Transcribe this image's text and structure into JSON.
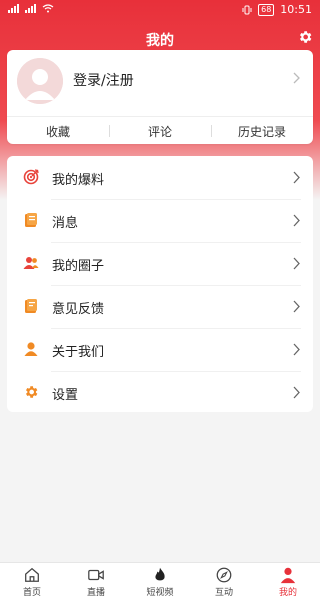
{
  "status_bar": {
    "battery": "68",
    "time": "10:51"
  },
  "header": {
    "title": "我的"
  },
  "profile": {
    "login_label": "登录/注册"
  },
  "profile_tabs": [
    "收藏",
    "评论",
    "历史记录"
  ],
  "menu": {
    "items": [
      {
        "label": "我的爆料",
        "icon": "target-icon"
      },
      {
        "label": "消息",
        "icon": "message-icon"
      },
      {
        "label": "我的圈子",
        "icon": "group-icon"
      },
      {
        "label": "意见反馈",
        "icon": "feedback-icon"
      },
      {
        "label": "关于我们",
        "icon": "person-icon"
      },
      {
        "label": "设置",
        "icon": "gear-icon"
      }
    ]
  },
  "bottom_nav": [
    {
      "label": "首页",
      "icon": "home-icon",
      "active": false
    },
    {
      "label": "直播",
      "icon": "video-icon",
      "active": false
    },
    {
      "label": "短视频",
      "icon": "flame-icon",
      "active": false
    },
    {
      "label": "互动",
      "icon": "compass-icon",
      "active": false
    },
    {
      "label": "我的",
      "icon": "profile-icon",
      "active": true
    }
  ],
  "colors": {
    "accent": "#e7313a",
    "icon_orange": "#f08a24",
    "icon_red": "#e8433b"
  }
}
